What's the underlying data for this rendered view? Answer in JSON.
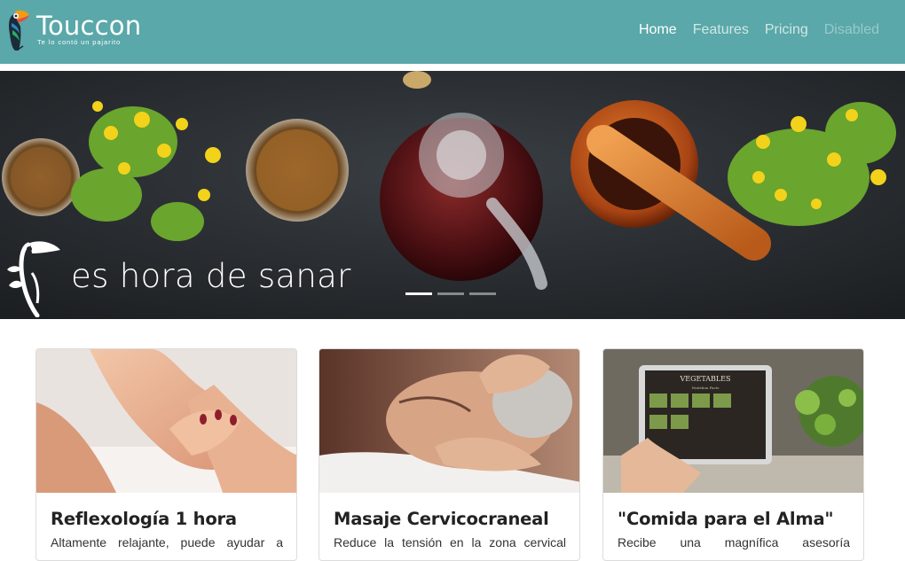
{
  "navbar": {
    "brand_name": "Touccon",
    "brand_tagline": "Te lo contó un pajarito",
    "links": [
      {
        "label": "Home",
        "state": "active"
      },
      {
        "label": "Features",
        "state": "normal"
      },
      {
        "label": "Pricing",
        "state": "normal"
      },
      {
        "label": "Disabled",
        "state": "disabled"
      }
    ],
    "bg_color": "#5aa8a9"
  },
  "hero": {
    "caption": "es hora de sanar",
    "indicator_count": 3,
    "active_indicator": 1
  },
  "cards": [
    {
      "title": "Reflexología 1 hora",
      "text": "Altamente relajante, puede ayudar a"
    },
    {
      "title": "Masaje Cervicocraneal",
      "text": "Reduce la tensión en la zona cervical"
    },
    {
      "title": "\"Comida para el Alma\"",
      "text": "Recibe una magnífica asesoría",
      "tablet_heading": "VEGETABLES",
      "tablet_subheading": "Nutrition Facts"
    }
  ]
}
